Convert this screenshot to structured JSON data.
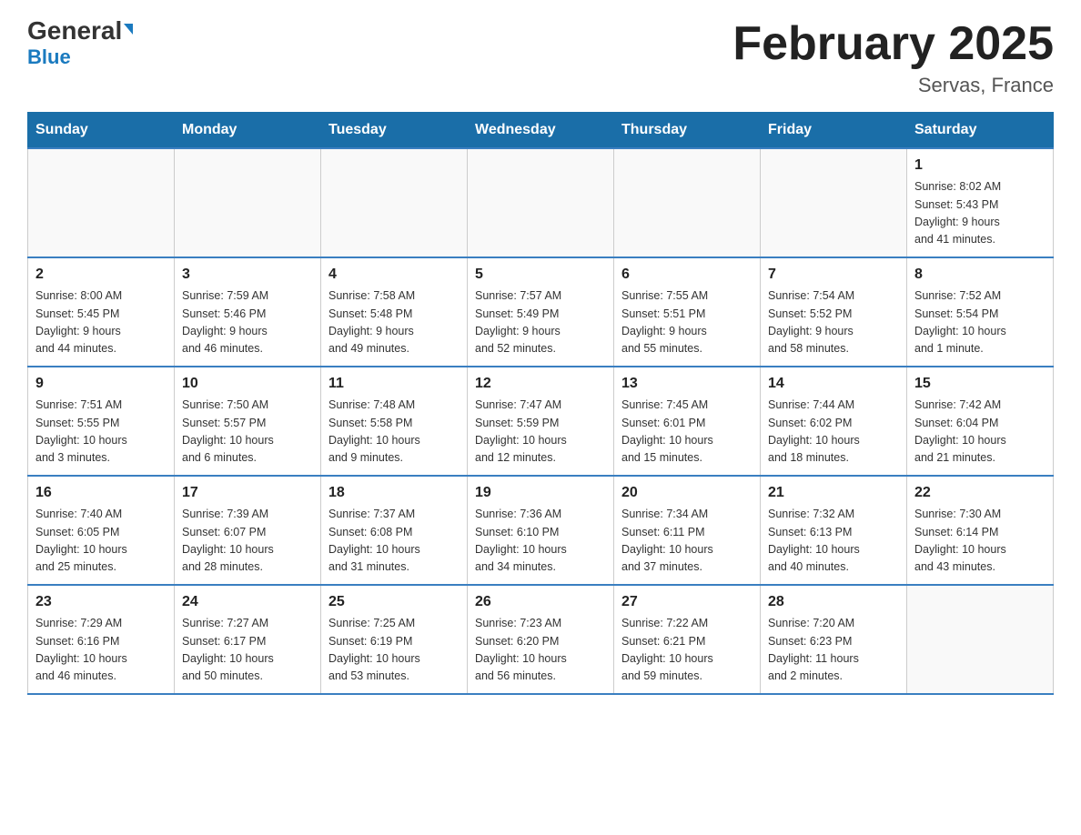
{
  "header": {
    "logo_general": "General",
    "logo_blue": "Blue",
    "title": "February 2025",
    "subtitle": "Servas, France"
  },
  "days_of_week": [
    "Sunday",
    "Monday",
    "Tuesday",
    "Wednesday",
    "Thursday",
    "Friday",
    "Saturday"
  ],
  "weeks": [
    [
      {
        "day": "",
        "info": ""
      },
      {
        "day": "",
        "info": ""
      },
      {
        "day": "",
        "info": ""
      },
      {
        "day": "",
        "info": ""
      },
      {
        "day": "",
        "info": ""
      },
      {
        "day": "",
        "info": ""
      },
      {
        "day": "1",
        "info": "Sunrise: 8:02 AM\nSunset: 5:43 PM\nDaylight: 9 hours\nand 41 minutes."
      }
    ],
    [
      {
        "day": "2",
        "info": "Sunrise: 8:00 AM\nSunset: 5:45 PM\nDaylight: 9 hours\nand 44 minutes."
      },
      {
        "day": "3",
        "info": "Sunrise: 7:59 AM\nSunset: 5:46 PM\nDaylight: 9 hours\nand 46 minutes."
      },
      {
        "day": "4",
        "info": "Sunrise: 7:58 AM\nSunset: 5:48 PM\nDaylight: 9 hours\nand 49 minutes."
      },
      {
        "day": "5",
        "info": "Sunrise: 7:57 AM\nSunset: 5:49 PM\nDaylight: 9 hours\nand 52 minutes."
      },
      {
        "day": "6",
        "info": "Sunrise: 7:55 AM\nSunset: 5:51 PM\nDaylight: 9 hours\nand 55 minutes."
      },
      {
        "day": "7",
        "info": "Sunrise: 7:54 AM\nSunset: 5:52 PM\nDaylight: 9 hours\nand 58 minutes."
      },
      {
        "day": "8",
        "info": "Sunrise: 7:52 AM\nSunset: 5:54 PM\nDaylight: 10 hours\nand 1 minute."
      }
    ],
    [
      {
        "day": "9",
        "info": "Sunrise: 7:51 AM\nSunset: 5:55 PM\nDaylight: 10 hours\nand 3 minutes."
      },
      {
        "day": "10",
        "info": "Sunrise: 7:50 AM\nSunset: 5:57 PM\nDaylight: 10 hours\nand 6 minutes."
      },
      {
        "day": "11",
        "info": "Sunrise: 7:48 AM\nSunset: 5:58 PM\nDaylight: 10 hours\nand 9 minutes."
      },
      {
        "day": "12",
        "info": "Sunrise: 7:47 AM\nSunset: 5:59 PM\nDaylight: 10 hours\nand 12 minutes."
      },
      {
        "day": "13",
        "info": "Sunrise: 7:45 AM\nSunset: 6:01 PM\nDaylight: 10 hours\nand 15 minutes."
      },
      {
        "day": "14",
        "info": "Sunrise: 7:44 AM\nSunset: 6:02 PM\nDaylight: 10 hours\nand 18 minutes."
      },
      {
        "day": "15",
        "info": "Sunrise: 7:42 AM\nSunset: 6:04 PM\nDaylight: 10 hours\nand 21 minutes."
      }
    ],
    [
      {
        "day": "16",
        "info": "Sunrise: 7:40 AM\nSunset: 6:05 PM\nDaylight: 10 hours\nand 25 minutes."
      },
      {
        "day": "17",
        "info": "Sunrise: 7:39 AM\nSunset: 6:07 PM\nDaylight: 10 hours\nand 28 minutes."
      },
      {
        "day": "18",
        "info": "Sunrise: 7:37 AM\nSunset: 6:08 PM\nDaylight: 10 hours\nand 31 minutes."
      },
      {
        "day": "19",
        "info": "Sunrise: 7:36 AM\nSunset: 6:10 PM\nDaylight: 10 hours\nand 34 minutes."
      },
      {
        "day": "20",
        "info": "Sunrise: 7:34 AM\nSunset: 6:11 PM\nDaylight: 10 hours\nand 37 minutes."
      },
      {
        "day": "21",
        "info": "Sunrise: 7:32 AM\nSunset: 6:13 PM\nDaylight: 10 hours\nand 40 minutes."
      },
      {
        "day": "22",
        "info": "Sunrise: 7:30 AM\nSunset: 6:14 PM\nDaylight: 10 hours\nand 43 minutes."
      }
    ],
    [
      {
        "day": "23",
        "info": "Sunrise: 7:29 AM\nSunset: 6:16 PM\nDaylight: 10 hours\nand 46 minutes."
      },
      {
        "day": "24",
        "info": "Sunrise: 7:27 AM\nSunset: 6:17 PM\nDaylight: 10 hours\nand 50 minutes."
      },
      {
        "day": "25",
        "info": "Sunrise: 7:25 AM\nSunset: 6:19 PM\nDaylight: 10 hours\nand 53 minutes."
      },
      {
        "day": "26",
        "info": "Sunrise: 7:23 AM\nSunset: 6:20 PM\nDaylight: 10 hours\nand 56 minutes."
      },
      {
        "day": "27",
        "info": "Sunrise: 7:22 AM\nSunset: 6:21 PM\nDaylight: 10 hours\nand 59 minutes."
      },
      {
        "day": "28",
        "info": "Sunrise: 7:20 AM\nSunset: 6:23 PM\nDaylight: 11 hours\nand 2 minutes."
      },
      {
        "day": "",
        "info": ""
      }
    ]
  ]
}
